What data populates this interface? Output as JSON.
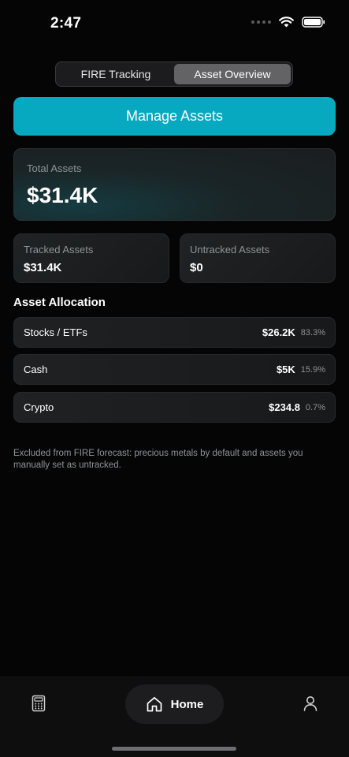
{
  "status_bar": {
    "time": "2:47"
  },
  "tabs": {
    "fire_tracking": "FIRE Tracking",
    "asset_overview": "Asset Overview"
  },
  "manage_button": "Manage Assets",
  "total_assets": {
    "label": "Total Assets",
    "value": "$31.4K"
  },
  "tracked_assets": {
    "label": "Tracked Assets",
    "value": "$31.4K"
  },
  "untracked_assets": {
    "label": "Untracked Assets",
    "value": "$0"
  },
  "allocation": {
    "title": "Asset Allocation",
    "items": [
      {
        "name": "Stocks / ETFs",
        "value": "$26.2K",
        "percent": "83.3%"
      },
      {
        "name": "Cash",
        "value": "$5K",
        "percent": "15.9%"
      },
      {
        "name": "Crypto",
        "value": "$234.8",
        "percent": "0.7%"
      }
    ]
  },
  "footnote": "Excluded from FIRE forecast: precious metals by default and assets you manually set as untracked.",
  "tab_bar": {
    "home_label": "Home",
    "icons": [
      "calculator-icon",
      "home-icon",
      "profile-icon"
    ]
  },
  "colors": {
    "accent": "#06a9bf",
    "background": "#050505",
    "card": "#1c1e20",
    "muted_text": "#8e9496"
  }
}
